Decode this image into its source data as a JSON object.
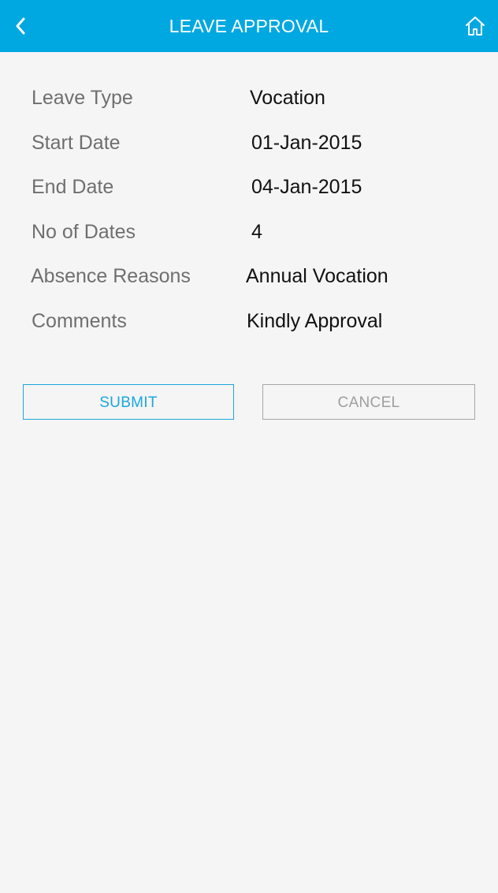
{
  "header": {
    "title": "LEAVE APPROVAL",
    "back_icon": "chevron-left-icon",
    "home_icon": "home-icon",
    "bg_color": "#00a8e1"
  },
  "details": [
    {
      "label": "Leave Type",
      "value": "Vocation"
    },
    {
      "label": "Start Date",
      "value": "01-Jan-2015"
    },
    {
      "label": "End Date",
      "value": "04-Jan-2015"
    },
    {
      "label": "No of Dates",
      "value": "4"
    },
    {
      "label": "Absence Reasons",
      "value": "Annual Vocation"
    },
    {
      "label": "Comments",
      "value": "Kindly Approval"
    }
  ],
  "actions": {
    "submit_label": "SUBMIT",
    "cancel_label": "CANCEL",
    "submit_color": "#1aa7dc",
    "cancel_color": "#9e9e9e"
  }
}
